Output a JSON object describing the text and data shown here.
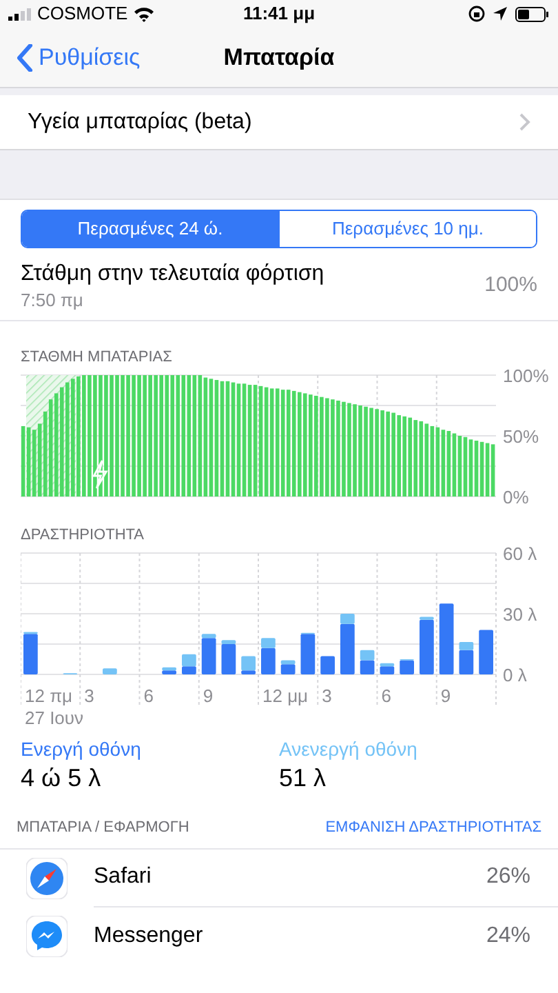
{
  "status_bar": {
    "carrier": "COSMOTE",
    "time": "11:41 μμ"
  },
  "nav": {
    "back": "Ρυθμίσεις",
    "title": "Μπαταρία"
  },
  "health_row": {
    "label": "Υγεία μπαταρίας (beta)"
  },
  "tabs": [
    {
      "label": "Περασμένες 24 ώ.",
      "selected": true
    },
    {
      "label": "Περασμένες 10 ημ.",
      "selected": false
    }
  ],
  "last_charge": {
    "title": "Στάθμη στην τελευταία φόρτιση",
    "time": "7:50 πμ",
    "value": "100%"
  },
  "battery_level": {
    "heading": "ΣΤΑΘΜΗ ΜΠΑΤΑΡΙΑΣ",
    "chart_data": {
      "type": "bar",
      "ylim": [
        0,
        100
      ],
      "yticks": [
        {
          "value": 100,
          "label": "100%"
        },
        {
          "value": 50,
          "label": "50%"
        },
        {
          "value": 0,
          "label": "0%"
        }
      ],
      "series": [
        {
          "color": "#4cd964",
          "values": [
            58,
            57,
            55,
            60,
            70,
            80,
            85,
            90,
            94,
            97,
            99,
            100,
            100,
            100,
            100,
            100,
            100,
            100,
            100,
            100,
            100,
            100,
            100,
            100,
            100,
            100,
            100,
            100,
            100,
            100,
            100,
            100,
            100,
            98,
            97,
            96,
            95,
            95,
            94,
            93,
            93,
            92,
            92,
            91,
            90,
            89,
            89,
            88,
            88,
            87,
            86,
            85,
            84,
            83,
            82,
            81,
            80,
            79,
            78,
            77,
            76,
            75,
            74,
            73,
            72,
            71,
            70,
            69,
            67,
            66,
            65,
            63,
            62,
            60,
            58,
            57,
            55,
            54,
            52,
            50,
            49,
            47,
            46,
            45,
            44,
            43
          ]
        }
      ],
      "orientation": "vertical"
    }
  },
  "activity": {
    "heading": "ΔΡΑΣΤΗΡΙΟΤΗΤΑ",
    "date": "27 Ιουν",
    "hour_labels": [
      "12 πμ",
      "3",
      "6",
      "9",
      "12 μμ",
      "3",
      "6",
      "9"
    ],
    "chart_data": {
      "type": "bar",
      "stacked": true,
      "ylim": [
        0,
        60
      ],
      "yticks": [
        {
          "value": 60,
          "label": "60 λ"
        },
        {
          "value": 30,
          "label": "30 λ"
        },
        {
          "value": 0,
          "label": "0 λ"
        }
      ],
      "series": [
        {
          "name": "Ενεργή οθόνη",
          "color": "#3478f6",
          "values": [
            20,
            0,
            0,
            0,
            0,
            0,
            0,
            2,
            4,
            18,
            15,
            2,
            13,
            5,
            20,
            9,
            25,
            7,
            4,
            7,
            27,
            35,
            12,
            22
          ]
        },
        {
          "name": "Ανενεργή οθόνη",
          "color": "#74c3f6",
          "values": [
            1,
            0,
            0.6,
            0,
            3,
            0,
            0,
            1.5,
            6,
            2,
            2,
            7,
            5,
            2,
            0.5,
            0,
            5,
            5,
            1.5,
            0.5,
            1.5,
            0,
            4,
            0
          ]
        }
      ]
    }
  },
  "screen_time": [
    {
      "value": "4 ώ 5 λ"
    },
    {
      "value": "51 λ"
    }
  ],
  "apps_header": {
    "title": "ΜΠΑΤΑΡΙΑ / ΕΦΑΡΜΟΓΗ",
    "action": "ΕΜΦΑΝΙΣΗ ΔΡΑΣΤΗΡΙΟΤΗΤΑΣ"
  },
  "apps": [
    {
      "kind": "compass",
      "name": "Safari",
      "value": "26%"
    },
    {
      "kind": "messenger",
      "name": "Messenger",
      "value": "24%"
    }
  ]
}
